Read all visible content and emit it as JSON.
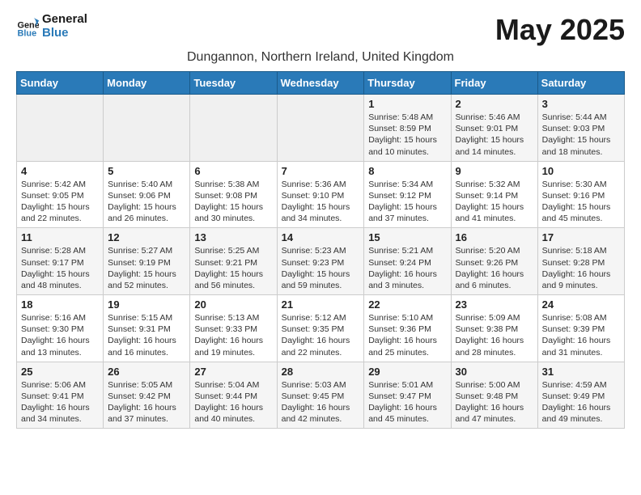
{
  "logo": {
    "line1": "General",
    "line2": "Blue"
  },
  "title": "May 2025",
  "location": "Dungannon, Northern Ireland, United Kingdom",
  "weekdays": [
    "Sunday",
    "Monday",
    "Tuesday",
    "Wednesday",
    "Thursday",
    "Friday",
    "Saturday"
  ],
  "weeks": [
    [
      {
        "day": "",
        "content": ""
      },
      {
        "day": "",
        "content": ""
      },
      {
        "day": "",
        "content": ""
      },
      {
        "day": "",
        "content": ""
      },
      {
        "day": "1",
        "content": "Sunrise: 5:48 AM\nSunset: 8:59 PM\nDaylight: 15 hours\nand 10 minutes."
      },
      {
        "day": "2",
        "content": "Sunrise: 5:46 AM\nSunset: 9:01 PM\nDaylight: 15 hours\nand 14 minutes."
      },
      {
        "day": "3",
        "content": "Sunrise: 5:44 AM\nSunset: 9:03 PM\nDaylight: 15 hours\nand 18 minutes."
      }
    ],
    [
      {
        "day": "4",
        "content": "Sunrise: 5:42 AM\nSunset: 9:05 PM\nDaylight: 15 hours\nand 22 minutes."
      },
      {
        "day": "5",
        "content": "Sunrise: 5:40 AM\nSunset: 9:06 PM\nDaylight: 15 hours\nand 26 minutes."
      },
      {
        "day": "6",
        "content": "Sunrise: 5:38 AM\nSunset: 9:08 PM\nDaylight: 15 hours\nand 30 minutes."
      },
      {
        "day": "7",
        "content": "Sunrise: 5:36 AM\nSunset: 9:10 PM\nDaylight: 15 hours\nand 34 minutes."
      },
      {
        "day": "8",
        "content": "Sunrise: 5:34 AM\nSunset: 9:12 PM\nDaylight: 15 hours\nand 37 minutes."
      },
      {
        "day": "9",
        "content": "Sunrise: 5:32 AM\nSunset: 9:14 PM\nDaylight: 15 hours\nand 41 minutes."
      },
      {
        "day": "10",
        "content": "Sunrise: 5:30 AM\nSunset: 9:16 PM\nDaylight: 15 hours\nand 45 minutes."
      }
    ],
    [
      {
        "day": "11",
        "content": "Sunrise: 5:28 AM\nSunset: 9:17 PM\nDaylight: 15 hours\nand 48 minutes."
      },
      {
        "day": "12",
        "content": "Sunrise: 5:27 AM\nSunset: 9:19 PM\nDaylight: 15 hours\nand 52 minutes."
      },
      {
        "day": "13",
        "content": "Sunrise: 5:25 AM\nSunset: 9:21 PM\nDaylight: 15 hours\nand 56 minutes."
      },
      {
        "day": "14",
        "content": "Sunrise: 5:23 AM\nSunset: 9:23 PM\nDaylight: 15 hours\nand 59 minutes."
      },
      {
        "day": "15",
        "content": "Sunrise: 5:21 AM\nSunset: 9:24 PM\nDaylight: 16 hours\nand 3 minutes."
      },
      {
        "day": "16",
        "content": "Sunrise: 5:20 AM\nSunset: 9:26 PM\nDaylight: 16 hours\nand 6 minutes."
      },
      {
        "day": "17",
        "content": "Sunrise: 5:18 AM\nSunset: 9:28 PM\nDaylight: 16 hours\nand 9 minutes."
      }
    ],
    [
      {
        "day": "18",
        "content": "Sunrise: 5:16 AM\nSunset: 9:30 PM\nDaylight: 16 hours\nand 13 minutes."
      },
      {
        "day": "19",
        "content": "Sunrise: 5:15 AM\nSunset: 9:31 PM\nDaylight: 16 hours\nand 16 minutes."
      },
      {
        "day": "20",
        "content": "Sunrise: 5:13 AM\nSunset: 9:33 PM\nDaylight: 16 hours\nand 19 minutes."
      },
      {
        "day": "21",
        "content": "Sunrise: 5:12 AM\nSunset: 9:35 PM\nDaylight: 16 hours\nand 22 minutes."
      },
      {
        "day": "22",
        "content": "Sunrise: 5:10 AM\nSunset: 9:36 PM\nDaylight: 16 hours\nand 25 minutes."
      },
      {
        "day": "23",
        "content": "Sunrise: 5:09 AM\nSunset: 9:38 PM\nDaylight: 16 hours\nand 28 minutes."
      },
      {
        "day": "24",
        "content": "Sunrise: 5:08 AM\nSunset: 9:39 PM\nDaylight: 16 hours\nand 31 minutes."
      }
    ],
    [
      {
        "day": "25",
        "content": "Sunrise: 5:06 AM\nSunset: 9:41 PM\nDaylight: 16 hours\nand 34 minutes."
      },
      {
        "day": "26",
        "content": "Sunrise: 5:05 AM\nSunset: 9:42 PM\nDaylight: 16 hours\nand 37 minutes."
      },
      {
        "day": "27",
        "content": "Sunrise: 5:04 AM\nSunset: 9:44 PM\nDaylight: 16 hours\nand 40 minutes."
      },
      {
        "day": "28",
        "content": "Sunrise: 5:03 AM\nSunset: 9:45 PM\nDaylight: 16 hours\nand 42 minutes."
      },
      {
        "day": "29",
        "content": "Sunrise: 5:01 AM\nSunset: 9:47 PM\nDaylight: 16 hours\nand 45 minutes."
      },
      {
        "day": "30",
        "content": "Sunrise: 5:00 AM\nSunset: 9:48 PM\nDaylight: 16 hours\nand 47 minutes."
      },
      {
        "day": "31",
        "content": "Sunrise: 4:59 AM\nSunset: 9:49 PM\nDaylight: 16 hours\nand 49 minutes."
      }
    ]
  ]
}
